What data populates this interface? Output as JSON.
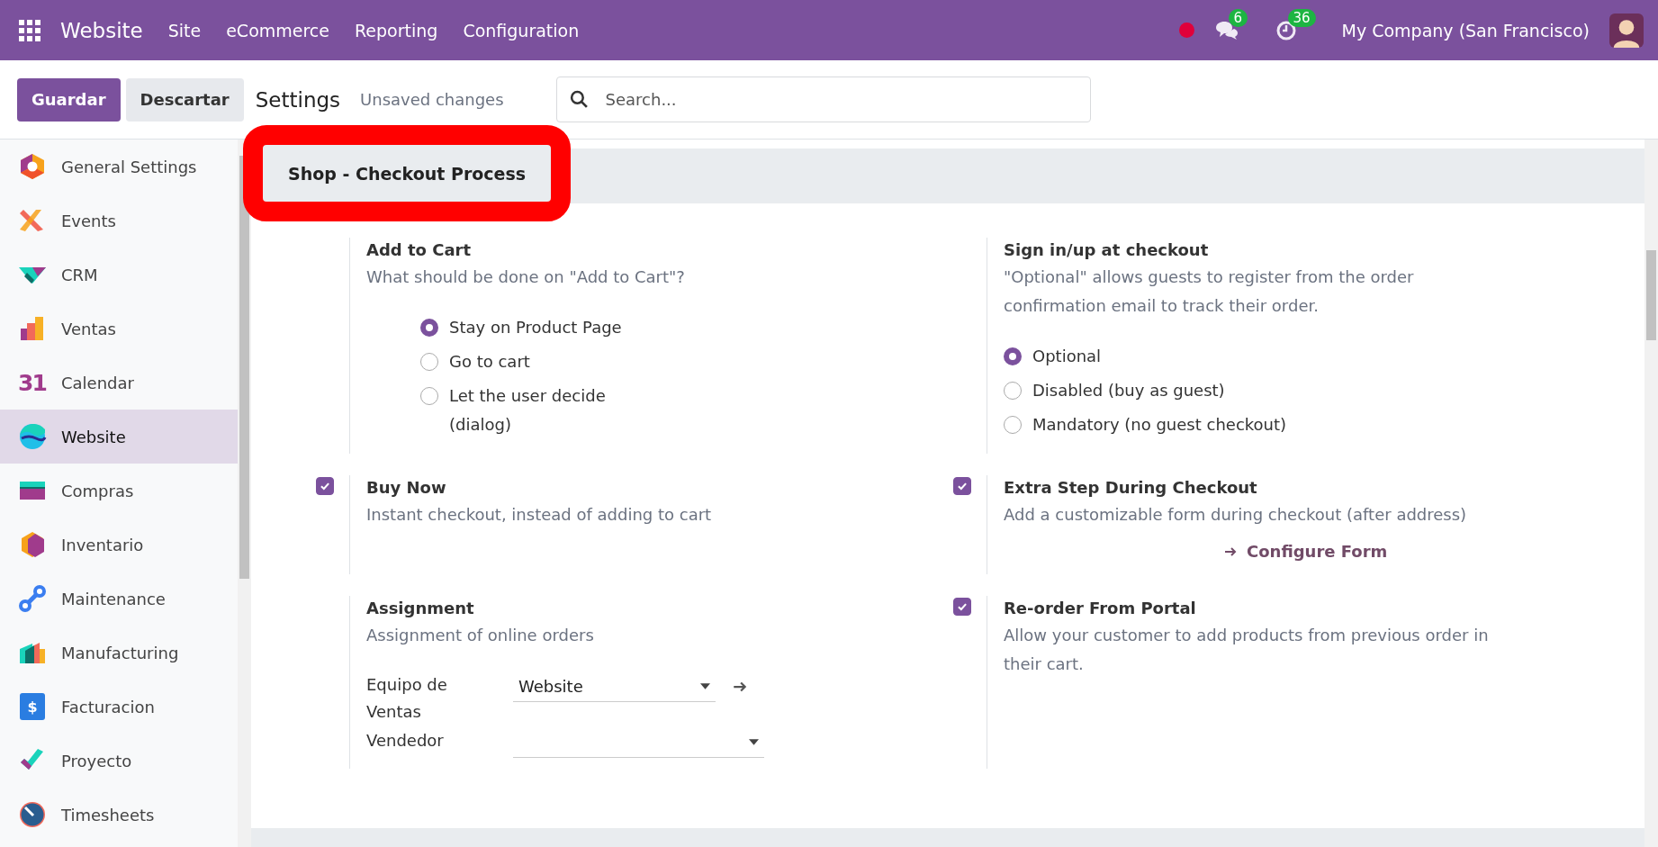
{
  "topbar": {
    "brand": "Website",
    "menu": [
      "Site",
      "eCommerce",
      "Reporting",
      "Configuration"
    ],
    "messages_badge": "6",
    "activities_badge": "36",
    "company": "My Company (San Francisco)"
  },
  "control_panel": {
    "save_button": "Guardar",
    "discard_button": "Descartar",
    "title": "Settings",
    "status": "Unsaved changes",
    "search": {
      "placeholder": "Search..."
    }
  },
  "sidebar": {
    "items": [
      {
        "label": "General Settings",
        "selected": false
      },
      {
        "label": "Events",
        "selected": false
      },
      {
        "label": "CRM",
        "selected": false
      },
      {
        "label": "Ventas",
        "selected": false
      },
      {
        "label": "Calendar",
        "icon_text": "31",
        "selected": false
      },
      {
        "label": "Website",
        "selected": true
      },
      {
        "label": "Compras",
        "selected": false
      },
      {
        "label": "Inventario",
        "selected": false
      },
      {
        "label": "Maintenance",
        "selected": false
      },
      {
        "label": "Manufacturing",
        "selected": false
      },
      {
        "label": "Facturacion",
        "icon_text": "$",
        "selected": false
      },
      {
        "label": "Proyecto",
        "selected": false
      },
      {
        "label": "Timesheets",
        "selected": false
      }
    ]
  },
  "section": {
    "title": "Shop - Checkout Process",
    "highlighted": true
  },
  "settings": [
    {
      "kind": "radio",
      "title": "Add to Cart",
      "description": "What should be done on \"Add to Cart\"?",
      "options_indented": true,
      "options": [
        {
          "label": "Stay on Product Page",
          "selected": true
        },
        {
          "label": "Go to cart",
          "selected": false
        },
        {
          "label": "Let the user decide (dialog)",
          "selected": false
        }
      ]
    },
    {
      "kind": "radio",
      "title": "Sign in/up at checkout",
      "description": "\"Optional\" allows guests to register from the order confirmation email to track their order.",
      "options_indented": false,
      "options": [
        {
          "label": "Optional",
          "selected": true
        },
        {
          "label": "Disabled (buy as guest)",
          "selected": false
        },
        {
          "label": "Mandatory (no guest checkout)",
          "selected": false
        }
      ]
    },
    {
      "kind": "checkbox",
      "checked": true,
      "title": "Buy Now",
      "description": "Instant checkout, instead of adding to cart"
    },
    {
      "kind": "checkbox",
      "checked": true,
      "title": "Extra Step During Checkout",
      "description": "Add a customizable form during checkout (after address)",
      "link": "Configure Form"
    },
    {
      "kind": "fields",
      "title": "Assignment",
      "description": "Assignment of online orders",
      "fields": [
        {
          "label": "Equipo de Ventas",
          "value": "Website",
          "open_button": true
        },
        {
          "label": "Vendedor",
          "open_button": false
        }
      ]
    },
    {
      "kind": "checkbox",
      "checked": true,
      "title": "Re-order From Portal",
      "description": "Allow your customer to add products from previous order in their cart."
    }
  ]
}
